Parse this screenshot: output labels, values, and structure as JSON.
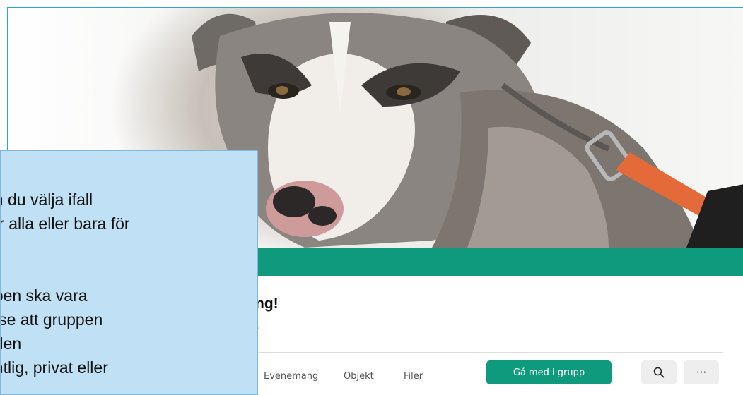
{
  "group": {
    "title": "ng!",
    "subtitle": "r"
  },
  "tabs": [
    {
      "label": "Evenemang"
    },
    {
      "label": "Objekt"
    },
    {
      "label": "Filer"
    }
  ],
  "actions": {
    "join_label": "Gå med i grupp",
    "search_icon": "search-icon",
    "more_label": "···"
  },
  "callout": {
    "lines": [
      "an du välja ifall",
      "för alla eller bara för",
      "",
      "ppen ska vara",
      "e se att gruppen",
      "uden",
      "entlig, privat eller"
    ]
  },
  "colors": {
    "accent": "#0f9a7d",
    "callout_bg": "#bfe0f5",
    "frame_border": "#2aa6c9"
  }
}
